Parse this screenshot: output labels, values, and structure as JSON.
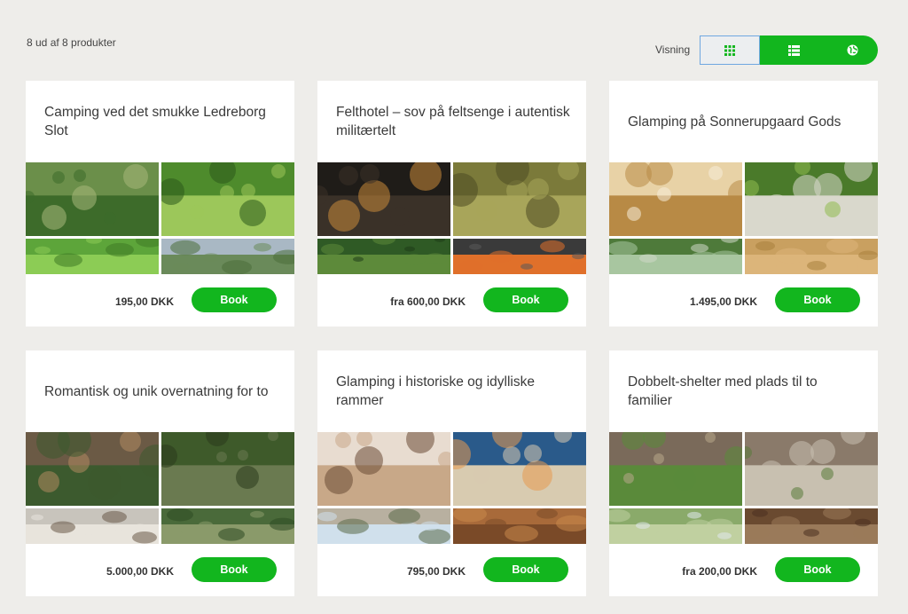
{
  "results_count": "8 ud af 8 produkter",
  "view": {
    "label": "Visning",
    "options": [
      "grid-icon",
      "list-icon",
      "globe-icon"
    ],
    "active": "grid-icon",
    "accent": "#12b61e"
  },
  "book_label": "Book",
  "products": [
    {
      "title": "Camping ved det smukke Ledreborg Slot",
      "price": "195,00 DKK",
      "images": [
        "aerial estate with green lawns",
        "zipline in forest",
        "tree canopy",
        "hills landscape"
      ]
    },
    {
      "title": "Felthotel – sov på feltsenge i autentisk militærtelt",
      "price": "fra 600,00 DKK",
      "images": [
        "lanterns at night",
        "tent interior cots",
        "forest trees",
        "campfire"
      ]
    },
    {
      "title": "Glamping på Sonnerupgaard Gods",
      "price": "1.495,00 DKK",
      "images": [
        "bell tent interior",
        "bell tent in garden",
        "lawn chair",
        "wooden deck"
      ]
    },
    {
      "title": "Romantisk og unik overnatning for to",
      "price": "5.000,00 DKK",
      "images": [
        "treehouse deck",
        "forest pavilion",
        "interior room",
        "garden path"
      ]
    },
    {
      "title": "Glamping i historiske og idylliske rammer",
      "price": "795,00 DKK",
      "images": [
        "tipi interior",
        "tipis at dusk",
        "tent outdoors",
        "wooden cabin"
      ]
    },
    {
      "title": "Dobbelt-shelter med plads til to familier",
      "price": "fra 200,00 DKK",
      "images": [
        "wooden shelter",
        "double shelter",
        "meadow",
        "shelter wall"
      ]
    }
  ],
  "colors": {
    "background": "#eeedea",
    "card": "#ffffff",
    "button": "#12b61e"
  }
}
